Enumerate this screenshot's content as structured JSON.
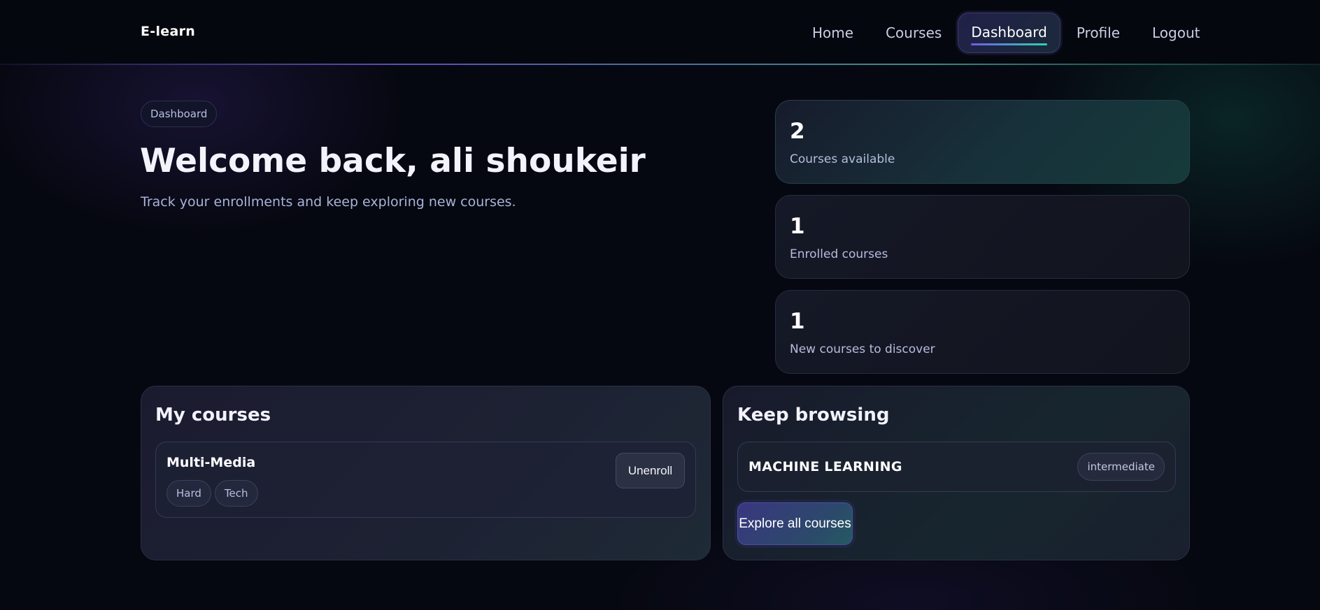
{
  "nav": {
    "brand": "E-learn",
    "links": [
      {
        "label": "Home",
        "active": false
      },
      {
        "label": "Courses",
        "active": false
      },
      {
        "label": "Dashboard",
        "active": true
      },
      {
        "label": "Profile",
        "active": false
      },
      {
        "label": "Logout",
        "active": false
      }
    ]
  },
  "hero": {
    "pill": "Dashboard",
    "title": "Welcome back, ali shoukeir",
    "subtitle": "Track your enrollments and keep exploring new courses."
  },
  "stats": [
    {
      "value": "2",
      "label": "Courses available"
    },
    {
      "value": "1",
      "label": "Enrolled courses"
    },
    {
      "value": "1",
      "label": "New courses to discover"
    }
  ],
  "my_courses": {
    "title": "My courses",
    "items": [
      {
        "name": "Multi-Media",
        "tags": [
          "Hard",
          "Tech"
        ],
        "action_label": "Unenroll"
      }
    ]
  },
  "keep_browsing": {
    "title": "Keep browsing",
    "items": [
      {
        "name": "MACHINE LEARNING",
        "level": "intermediate"
      }
    ],
    "explore_label": "Explore all courses"
  },
  "colors": {
    "background": "#060811",
    "accent_start": "#6c5ce7",
    "accent_end": "#2bd4b0"
  }
}
